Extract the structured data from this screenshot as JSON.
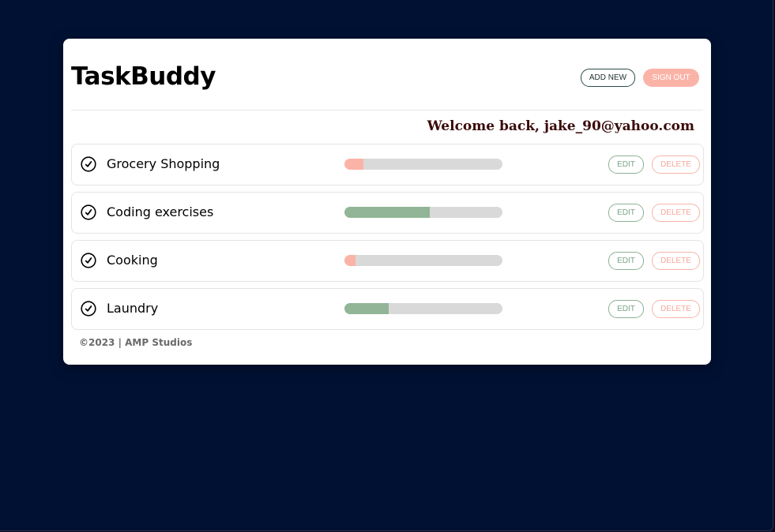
{
  "app": {
    "title": "TaskBuddy"
  },
  "header": {
    "add_new_label": "ADD NEW",
    "sign_out_label": "SIGN OUT"
  },
  "welcome": {
    "text": "Welcome back, jake_90@yahoo.com"
  },
  "tasks": [
    {
      "name": "Grocery Shopping",
      "progress": 0.12,
      "status_color": "#fbb3a8",
      "edit_label": "EDIT",
      "delete_label": "DELETE",
      "icon": "check-circle-icon"
    },
    {
      "name": "Coding exercises",
      "progress": 0.54,
      "status_color": "#91b596",
      "edit_label": "EDIT",
      "delete_label": "DELETE",
      "icon": "check-circle-icon"
    },
    {
      "name": "Cooking",
      "progress": 0.07,
      "status_color": "#fbb3a8",
      "edit_label": "EDIT",
      "delete_label": "DELETE",
      "icon": "check-circle-icon"
    },
    {
      "name": "Laundry",
      "progress": 0.28,
      "status_color": "#91b596",
      "edit_label": "EDIT",
      "delete_label": "DELETE",
      "icon": "check-circle-icon"
    }
  ],
  "footer": {
    "text": "©2023 | AMP Studios"
  },
  "colors": {
    "background": "#011133",
    "card": "#ffffff",
    "accent_green": "#91b596",
    "accent_salmon": "#fbb3a8",
    "welcome_text": "#3a0a0a"
  }
}
